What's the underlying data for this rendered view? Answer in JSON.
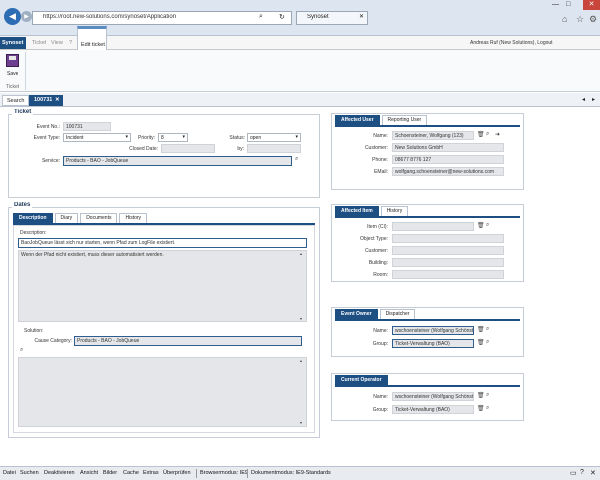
{
  "browser": {
    "url": "https://root.new-solutions.com/synoset/Application",
    "tab_title": "Synoset",
    "minimize": "—",
    "maximize": "□",
    "close": "✕"
  },
  "app": {
    "brand": "Synoset",
    "tabs": [
      "Ticket",
      "View",
      "?"
    ],
    "active_tab": "Edit ticket",
    "user_info": "Andreas Ruf (New Solutions), Logout"
  },
  "ribbon": {
    "save_label": "Save",
    "group_label": "Ticket"
  },
  "nav": {
    "search_tab": "Search",
    "ticket_tab": "100731",
    "close": "✕",
    "left": "◂",
    "right": "▸"
  },
  "ticket": {
    "legend": "Ticket",
    "event_no_label": "Event No.:",
    "event_no": "100731",
    "event_type_label": "Event Type:",
    "event_type": "Incident",
    "priority_label": "Priority:",
    "priority": "8",
    "status_label": "Status:",
    "status": "open",
    "closed_date_label": "Closed Date:",
    "by_label": "by:",
    "service_label": "Service:",
    "service": "Products - BAO - JobQueue"
  },
  "dates": {
    "legend": "Dates",
    "tabs": [
      "Description",
      "Diary",
      "Documents",
      "History"
    ],
    "description_label": "Description:",
    "description_title": "BaoJobQueue lässt sich nur starten, wenn Pfad zum LogFile existiert.",
    "description_body": "Wenn der Pfad nicht existiert, muss dieser automatisiert werden.",
    "solution_label": "Solution:",
    "cause_label": "Cause Category:",
    "cause": "Products - BAO - JobQueue"
  },
  "user": {
    "tabs": [
      "Affected User",
      "Reporting User"
    ],
    "name_label": "Name:",
    "name": "Schoensteiner, Wolfgang (123)",
    "customer_label": "Customer:",
    "customer": "New Solutions GmbH",
    "phone_label": "Phone:",
    "phone": "08677 8776 127",
    "email_label": "EMail:",
    "email": "wolfgang.schoensteiner@new-solutions.com"
  },
  "item": {
    "tabs": [
      "Affected Item",
      "History"
    ],
    "item_label": "Item (CI):",
    "object_type_label": "Object Type:",
    "customer_label": "Customer:",
    "building_label": "Building:",
    "room_label": "Room:"
  },
  "owner": {
    "tabs": [
      "Event Owner",
      "Dispatcher"
    ],
    "name_label": "Name:",
    "name": "wschoensteiner (Wolfgang Schönst",
    "group_label": "Group:",
    "group": "Ticket-Verwaltung (BAO)"
  },
  "operator": {
    "tabs": [
      "Current Operator"
    ],
    "name_label": "Name:",
    "name": "wschoensteiner (Wolfgang Schönst",
    "group_label": "Group:",
    "group": "Ticket-Verwaltung (BAO)"
  },
  "statusbar": {
    "menu": [
      "Datei",
      "Suchen",
      "Deaktivieren",
      "Ansicht",
      "Bilder",
      "Cache",
      "Extras",
      "Überprüfen",
      "Browsermodus: IE9",
      "Dokumentmodus: IE9-Standards"
    ]
  },
  "colors": {
    "accent": "#1d4f83",
    "browser_bg": "#dde6f0"
  },
  "icons": {
    "back": "back-arrow-icon",
    "forward": "forward-arrow-icon",
    "search": "magnifier-icon",
    "delete": "trash-icon",
    "link": "arrow-right-icon"
  }
}
